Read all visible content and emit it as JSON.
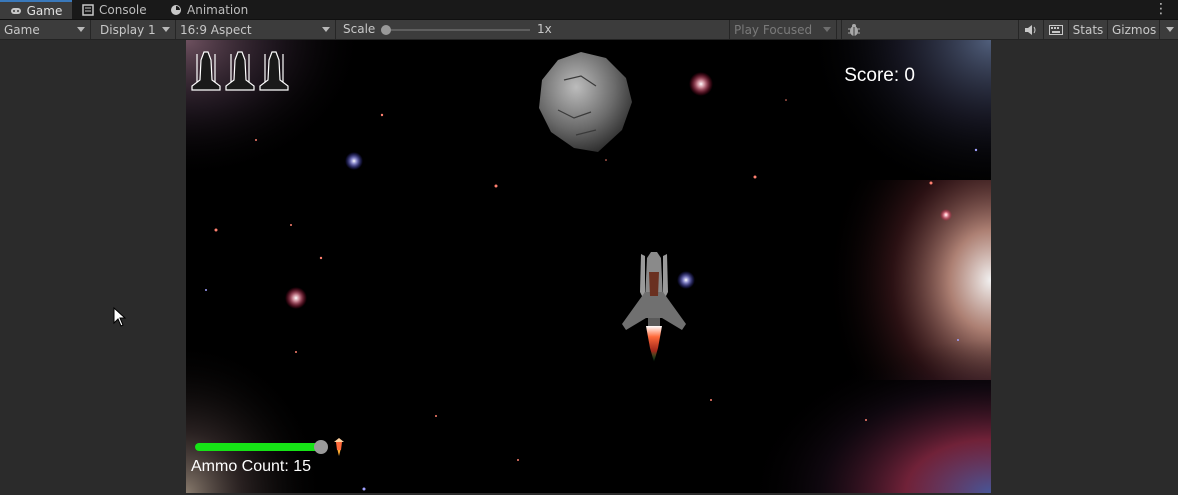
{
  "tabs": [
    {
      "label": "Game",
      "icon": "gamepad-icon",
      "active": true
    },
    {
      "label": "Console",
      "icon": "console-icon",
      "active": false
    },
    {
      "label": "Animation",
      "icon": "animation-icon",
      "active": false
    }
  ],
  "toolbar": {
    "view_select": "Game",
    "display_select": "Display 1",
    "aspect_select": "16:9 Aspect",
    "scale_label": "Scale",
    "scale_value": "1x",
    "play_mode_select": "Play Focused",
    "stats_label": "Stats",
    "gizmos_label": "Gizmos"
  },
  "game": {
    "score_text": "Score: 0",
    "ammo_text": "Ammo Count: 15",
    "ammo_fraction": 1.0,
    "lives": 3
  },
  "colors": {
    "accent": "#3a79bb",
    "ammo_bar": "#16e416"
  }
}
